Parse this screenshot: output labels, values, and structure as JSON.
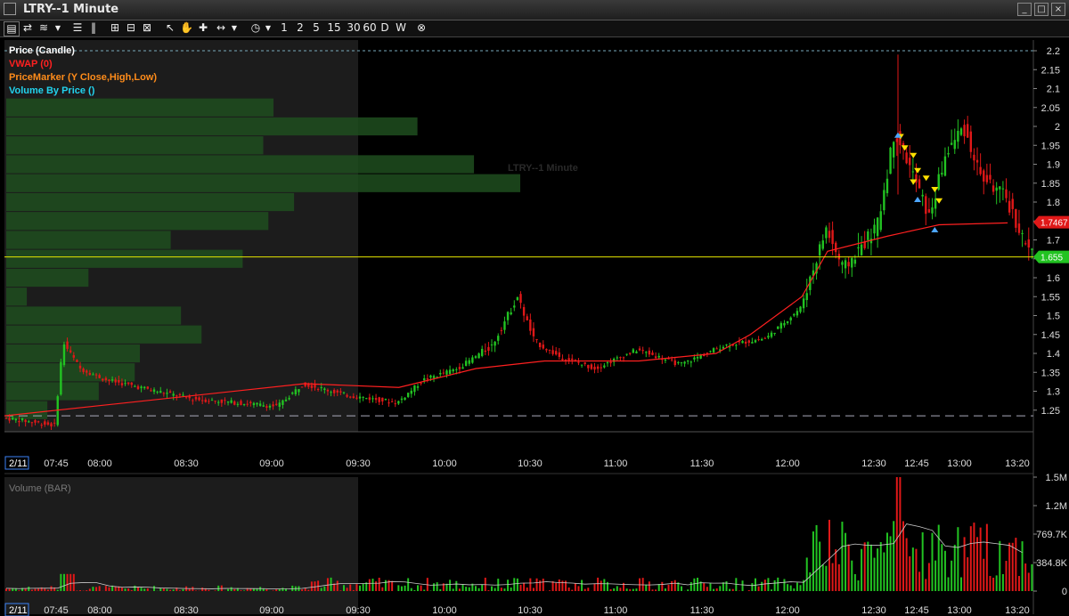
{
  "window": {
    "title": "LTRY--1 Minute"
  },
  "toolbar": {
    "intervals": [
      "1",
      "2",
      "5",
      "15",
      "30",
      "60",
      "D",
      "W"
    ]
  },
  "legend": [
    {
      "label": "Price (Candle)",
      "color": "#ffffff"
    },
    {
      "label": "VWAP (0)",
      "color": "#ff2020"
    },
    {
      "label": "PriceMarker (Y Close,High,Low)",
      "color": "#ff8c1a"
    },
    {
      "label": "Volume By Price ()",
      "color": "#22d3ee"
    }
  ],
  "watermark": "LTRY--1 Minute",
  "volume_title": "Volume (BAR)",
  "colors": {
    "up": "#22c322",
    "down": "#e01818",
    "vwap": "#ff2020",
    "price_line": "#e6e600",
    "premarket_bg": "#1c1c1c"
  },
  "chart_data": {
    "type": "candlestick",
    "price_axis": {
      "ticks": [
        "2.2",
        "2.15",
        "2.1",
        "2.05",
        "2",
        "1.95",
        "1.9",
        "1.85",
        "1.8",
        "1.75",
        "1.7",
        "1.65",
        "1.6",
        "1.55",
        "1.5",
        "1.45",
        "1.4",
        "1.35",
        "1.3",
        "1.25"
      ],
      "range": [
        1.2,
        2.2
      ]
    },
    "time_axis": {
      "date_label": "2/11",
      "ticks": [
        "07:45",
        "08:00",
        "08:30",
        "09:00",
        "09:30",
        "10:00",
        "10:30",
        "11:00",
        "11:30",
        "12:00",
        "12:30",
        "12:45",
        "13:00",
        "13:20"
      ]
    },
    "price_markers": [
      {
        "label": "1.7467",
        "value": 1.7467,
        "color": "#e01818"
      },
      {
        "label": "1.655",
        "value": 1.655,
        "color": "#22c322"
      }
    ],
    "close_line": 1.655,
    "dashed_high": 2.2,
    "dashed_low": 1.235,
    "vwap": [
      [
        0,
        1.235
      ],
      [
        0.35,
        1.32
      ],
      [
        0.46,
        1.31
      ],
      [
        0.55,
        1.36
      ],
      [
        0.63,
        1.38
      ],
      [
        0.74,
        1.38
      ],
      [
        0.83,
        1.4
      ],
      [
        0.87,
        1.45
      ],
      [
        0.93,
        1.55
      ],
      [
        0.96,
        1.67
      ],
      [
        1.03,
        1.71
      ],
      [
        1.09,
        1.74
      ],
      [
        1.17,
        1.745
      ]
    ],
    "price_path": [
      [
        0,
        1.23
      ],
      [
        0.06,
        1.21
      ],
      [
        0.07,
        1.43
      ],
      [
        0.09,
        1.36
      ],
      [
        0.12,
        1.33
      ],
      [
        0.22,
        1.28
      ],
      [
        0.32,
        1.26
      ],
      [
        0.35,
        1.32
      ],
      [
        0.4,
        1.29
      ],
      [
        0.46,
        1.27
      ],
      [
        0.49,
        1.33
      ],
      [
        0.53,
        1.36
      ],
      [
        0.57,
        1.42
      ],
      [
        0.6,
        1.55
      ],
      [
        0.62,
        1.43
      ],
      [
        0.65,
        1.39
      ],
      [
        0.69,
        1.36
      ],
      [
        0.74,
        1.41
      ],
      [
        0.79,
        1.37
      ],
      [
        0.84,
        1.42
      ],
      [
        0.89,
        1.44
      ],
      [
        0.93,
        1.52
      ],
      [
        0.96,
        1.73
      ],
      [
        0.98,
        1.62
      ],
      [
        1.0,
        1.68
      ],
      [
        1.02,
        1.74
      ],
      [
        1.04,
        1.99
      ],
      [
        1.06,
        1.88
      ],
      [
        1.08,
        1.76
      ],
      [
        1.1,
        1.93
      ],
      [
        1.12,
        2.0
      ],
      [
        1.14,
        1.87
      ],
      [
        1.17,
        1.81
      ],
      [
        1.19,
        1.7
      ],
      [
        1.2,
        1.66
      ]
    ],
    "volume_axis": {
      "ticks": [
        "1.5M",
        "1.2M",
        "769.7K",
        "384.8K",
        "0"
      ]
    },
    "volume_by_price": [
      {
        "price": 2.05,
        "rel": 0.52
      },
      {
        "price": 2.0,
        "rel": 0.8
      },
      {
        "price": 1.95,
        "rel": 0.5
      },
      {
        "price": 1.9,
        "rel": 0.91
      },
      {
        "price": 1.85,
        "rel": 1.0
      },
      {
        "price": 1.8,
        "rel": 0.56
      },
      {
        "price": 1.75,
        "rel": 0.51
      },
      {
        "price": 1.7,
        "rel": 0.32
      },
      {
        "price": 1.65,
        "rel": 0.46
      },
      {
        "price": 1.6,
        "rel": 0.16
      },
      {
        "price": 1.55,
        "rel": 0.04
      },
      {
        "price": 1.5,
        "rel": 0.34
      },
      {
        "price": 1.45,
        "rel": 0.38
      },
      {
        "price": 1.4,
        "rel": 0.26
      },
      {
        "price": 1.35,
        "rel": 0.25
      },
      {
        "price": 1.3,
        "rel": 0.18
      },
      {
        "price": 1.25,
        "rel": 0.08
      }
    ]
  }
}
